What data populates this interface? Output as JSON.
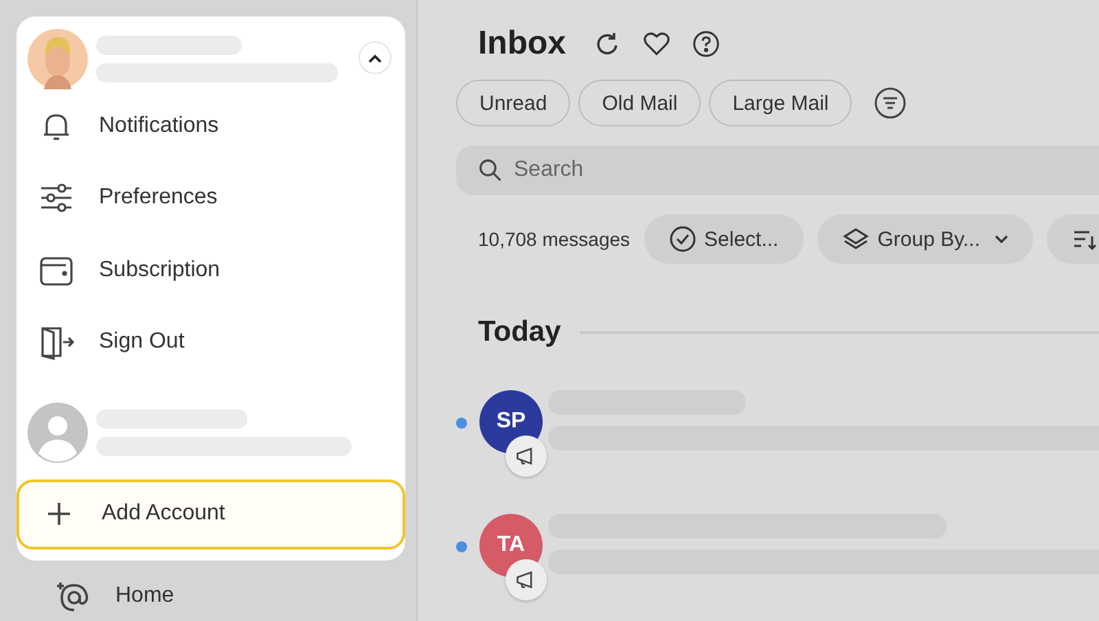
{
  "account_menu": {
    "collapse_expanded": true,
    "items": [
      {
        "kind": "bell",
        "label": "Notifications"
      },
      {
        "kind": "sliders",
        "label": "Preferences"
      },
      {
        "kind": "wallet",
        "label": "Subscription"
      },
      {
        "kind": "exit",
        "label": "Sign Out"
      }
    ],
    "add_account": {
      "label": "Add Account",
      "selected": true
    }
  },
  "sidebar": {
    "items": [
      {
        "kind": "at",
        "label": "Home"
      }
    ]
  },
  "main": {
    "title": "Inbox",
    "filters": [
      "Unread",
      "Old Mail",
      "Large Mail"
    ],
    "search": {
      "placeholder": "Search"
    },
    "message_count": "10,708 messages",
    "toolbar": [
      {
        "kind": "select",
        "label": "Select..."
      },
      {
        "kind": "group",
        "label": "Group By..."
      },
      {
        "kind": "sort"
      }
    ],
    "section": "Today",
    "messages": [
      {
        "initials": "SP",
        "color": "#2b3a9c",
        "unread": true
      },
      {
        "initials": "TA",
        "color": "#d55b67",
        "unread": true
      }
    ]
  }
}
